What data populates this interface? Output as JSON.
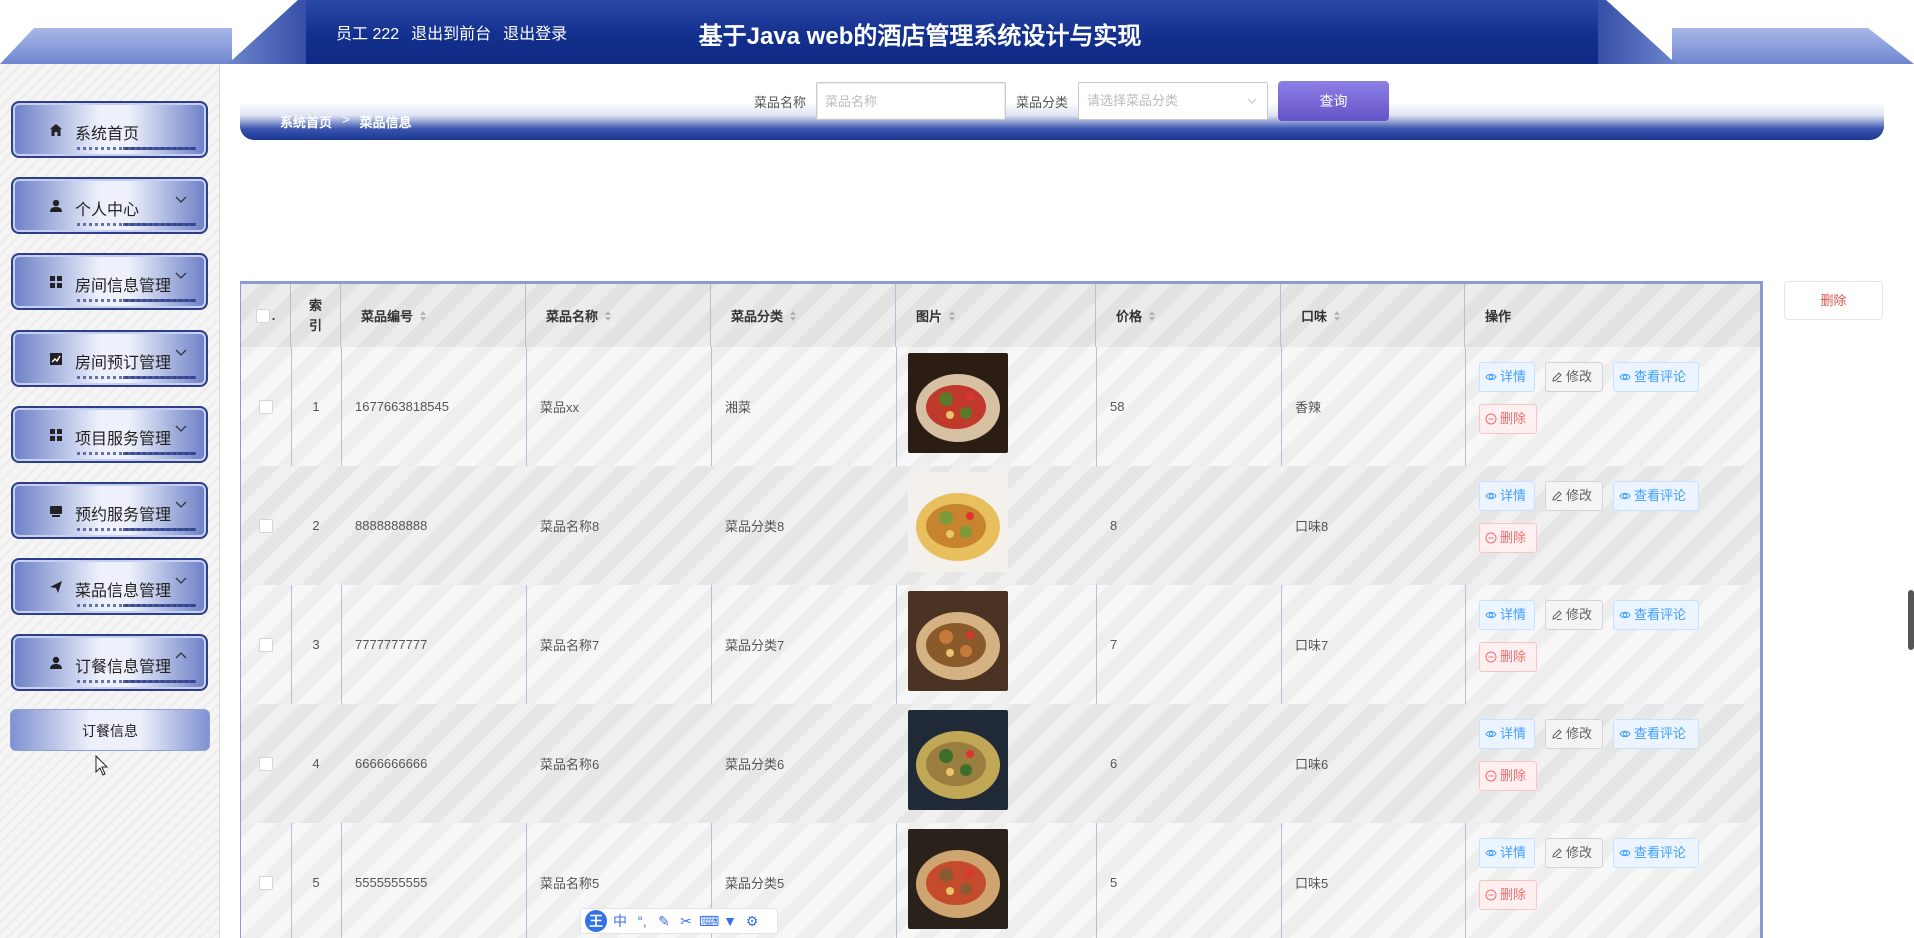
{
  "header": {
    "user_label": "员工 222",
    "to_frontend": "退出到前台",
    "logout": "退出登录",
    "title": "基于Java web的酒店管理系统设计与实现"
  },
  "sidebar": {
    "items": [
      {
        "label": "系统首页",
        "icon": "home-icon",
        "has_arrow": false
      },
      {
        "label": "个人中心",
        "icon": "user-icon",
        "has_arrow": true
      },
      {
        "label": "房间信息管理",
        "icon": "grid-icon",
        "has_arrow": true
      },
      {
        "label": "房间预订管理",
        "icon": "chart-icon",
        "has_arrow": true
      },
      {
        "label": "项目服务管理",
        "icon": "grid-icon",
        "has_arrow": true
      },
      {
        "label": "预约服务管理",
        "icon": "tray-icon",
        "has_arrow": true
      },
      {
        "label": "菜品信息管理",
        "icon": "send-icon",
        "has_arrow": true
      },
      {
        "label": "订餐信息管理",
        "icon": "user-icon",
        "has_arrow": true,
        "expanded": true
      }
    ],
    "sub_item": "订餐信息"
  },
  "breadcrumb": {
    "home": "系统首页",
    "separator": ">",
    "current": "菜品信息"
  },
  "search": {
    "name_label": "菜品名称",
    "name_placeholder": "菜品名称",
    "category_label": "菜品分类",
    "category_placeholder": "请选择菜品分类",
    "query_button": "查询"
  },
  "side_delete_button": "删除",
  "table": {
    "headers": {
      "index": "索引",
      "code": "菜品编号",
      "name": "菜品名称",
      "category": "菜品分类",
      "image": "图片",
      "price": "价格",
      "taste": "口味",
      "actions": "操作"
    },
    "rows": [
      {
        "index": "1",
        "code": "1677663818545",
        "name": "菜品xx",
        "category": "湘菜",
        "price": "58",
        "taste": "香辣"
      },
      {
        "index": "2",
        "code": "8888888888",
        "name": "菜品名称8",
        "category": "菜品分类8",
        "price": "8",
        "taste": "口味8"
      },
      {
        "index": "3",
        "code": "7777777777",
        "name": "菜品名称7",
        "category": "菜品分类7",
        "price": "7",
        "taste": "口味7"
      },
      {
        "index": "4",
        "code": "6666666666",
        "name": "菜品名称6",
        "category": "菜品分类6",
        "price": "6",
        "taste": "口味6"
      },
      {
        "index": "5",
        "code": "5555555555",
        "name": "菜品名称5",
        "category": "菜品分类5",
        "price": "5",
        "taste": "口味5"
      }
    ],
    "actions": {
      "detail": "详情",
      "edit": "修改",
      "review": "查看评论",
      "delete": "删除"
    }
  },
  "colors": {
    "header_blue": "#13308e",
    "query_purple": "#6554c7",
    "link_blue": "#409eff",
    "danger_red": "#f56c6c"
  }
}
